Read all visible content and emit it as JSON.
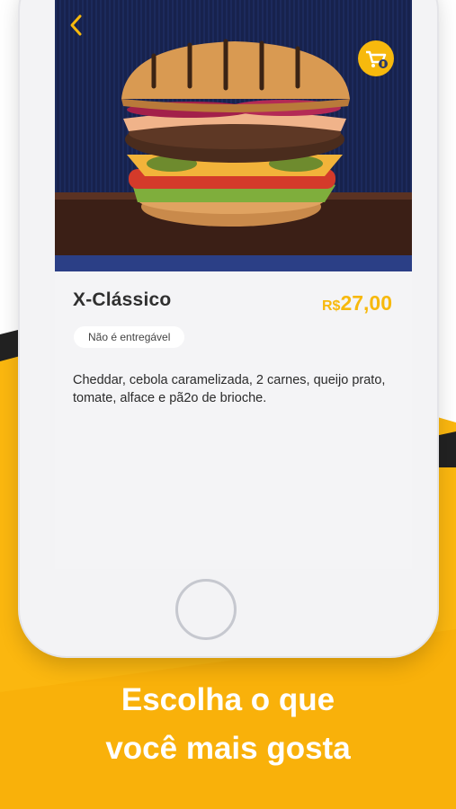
{
  "product": {
    "name": "X-Clássico",
    "price_currency": "R$",
    "price_value": "27,00",
    "delivery_badge": "Não é entregável",
    "description": "Cheddar, cebola caramelizada, 2 carnes, queijo prato, tomate, alface e pã2o de brioche."
  },
  "tagline": {
    "line1": "Escolha o que",
    "line2": "você mais gosta"
  },
  "icons": {
    "back": "chevron-left-icon",
    "cart": "shopping-cart-icon"
  },
  "colors": {
    "accent": "#f7b90d",
    "hero_background": "#16204a",
    "text_dark": "#2f2f2f"
  }
}
